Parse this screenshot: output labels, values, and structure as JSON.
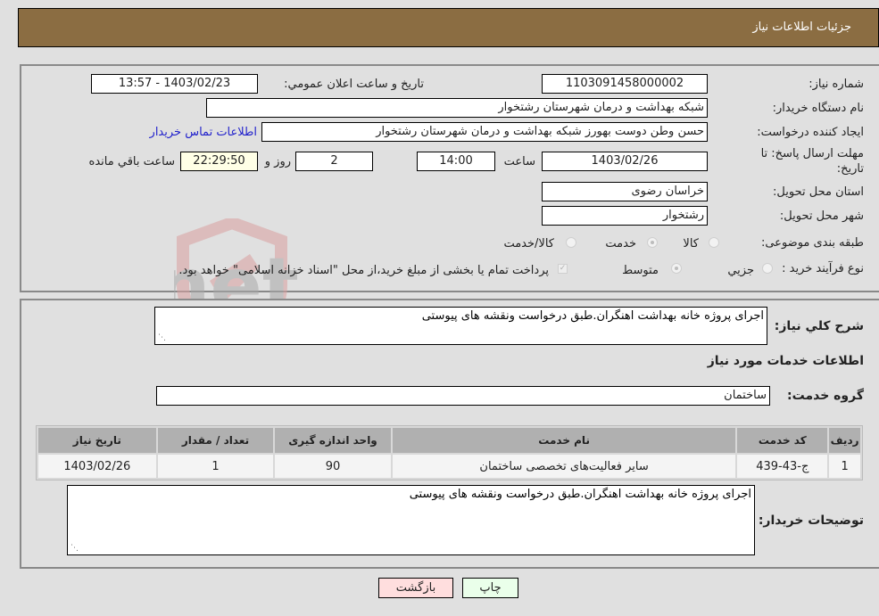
{
  "header": {
    "title": "جزئیات اطلاعات نیاز"
  },
  "form": {
    "need_number": {
      "label": "شماره نیاز:",
      "value": "1103091458000002"
    },
    "announce_datetime": {
      "label": "تاریخ و ساعت اعلان عمومي:",
      "value": "1403/02/23 - 13:57"
    },
    "buyer_org": {
      "label": "نام دستگاه خريدار:",
      "value": "شبکه بهداشت و درمان شهرستان رشتخوار"
    },
    "requester": {
      "label": "ايجاد کننده درخواست:",
      "value": "حسن وطن دوست بهورز شبکه بهداشت و درمان شهرستان رشتخوار"
    },
    "buyer_contact_link": "اطلاعات تماس خريدار",
    "deadline": {
      "label_line1": "مهلت ارسال پاسخ: تا",
      "label_line2": "تاریخ:",
      "date": "1403/02/26",
      "time_label": "ساعت",
      "time": "14:00",
      "days": "2",
      "days_label": "روز و",
      "remaining": "22:29:50",
      "remaining_label": "ساعت باقي مانده"
    },
    "province": {
      "label": "استان محل تحويل:",
      "value": "خراسان رضوی"
    },
    "city": {
      "label": "شهر محل تحويل:",
      "value": "رشتخوار"
    },
    "category": {
      "label": "طبقه بندی موضوعی:",
      "options": [
        "کالا",
        "خدمت",
        "کالا/خدمت"
      ],
      "selected": "خدمت"
    },
    "purchase_type": {
      "label": "نوع فرآیند خرید :",
      "options": [
        "جزيي",
        "متوسط"
      ],
      "selected": "متوسط",
      "treasury_note": "پرداخت تمام یا بخشی از مبلغ خرید،از محل \"اسناد خزانه اسلامی\" خواهد بود."
    }
  },
  "details": {
    "general_desc": {
      "label": "شرح کلي نياز:",
      "value": "اجرای پروژه خانه بهداشت اهنگران.طبق درخواست ونقشه های پیوستی"
    },
    "services_heading": "اطلاعات خدمات مورد نياز",
    "service_group": {
      "label": "گروه خدمت:",
      "value": "ساختمان"
    },
    "table": {
      "headers": [
        "رديف",
        "کد خدمت",
        "نام خدمت",
        "واحد اندازه گيری",
        "تعداد / مقدار",
        "تاريخ نياز"
      ],
      "rows": [
        [
          "1",
          "ج-43-439",
          "ساير فعاليت‌های تخصصی ساختمان",
          "90",
          "1",
          "1403/02/26"
        ]
      ]
    },
    "buyer_notes": {
      "label": "توضيحات خريدار:",
      "value": "اجرای پروژه خانه بهداشت اهنگران.طبق درخواست ونقشه های پیوستی"
    }
  },
  "buttons": {
    "print": "چاپ",
    "back": "بازگشت"
  },
  "watermark": {
    "text": "AriaTender.net"
  },
  "colors": {
    "header_bg": "#8b6d42",
    "print_bg": "#eaffea",
    "back_bg": "#ffdede",
    "link": "#2222cc"
  }
}
